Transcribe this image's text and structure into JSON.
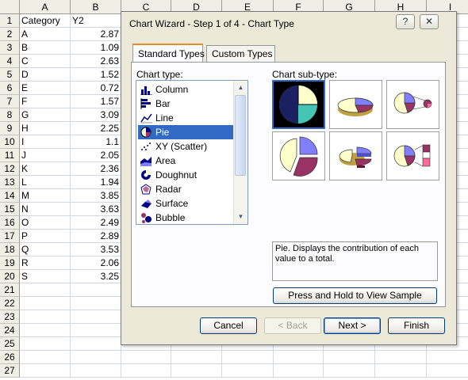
{
  "spreadsheet": {
    "columns": [
      "A",
      "B",
      "C",
      "D",
      "E",
      "F",
      "G",
      "H",
      "I"
    ],
    "rows": [
      {
        "n": "1",
        "a": "Category",
        "b": "Y2"
      },
      {
        "n": "2",
        "a": "A",
        "b": "2.87"
      },
      {
        "n": "3",
        "a": "B",
        "b": "1.09"
      },
      {
        "n": "4",
        "a": "C",
        "b": "2.63"
      },
      {
        "n": "5",
        "a": "D",
        "b": "1.52"
      },
      {
        "n": "6",
        "a": "E",
        "b": "0.72"
      },
      {
        "n": "7",
        "a": "F",
        "b": "1.57"
      },
      {
        "n": "8",
        "a": "G",
        "b": "3.09"
      },
      {
        "n": "9",
        "a": "H",
        "b": "2.25"
      },
      {
        "n": "10",
        "a": "I",
        "b": "1.1"
      },
      {
        "n": "11",
        "a": "J",
        "b": "2.05"
      },
      {
        "n": "12",
        "a": "K",
        "b": "2.36"
      },
      {
        "n": "13",
        "a": "L",
        "b": "1.94"
      },
      {
        "n": "14",
        "a": "M",
        "b": "3.85"
      },
      {
        "n": "15",
        "a": "N",
        "b": "3.63"
      },
      {
        "n": "16",
        "a": "O",
        "b": "2.49"
      },
      {
        "n": "17",
        "a": "P",
        "b": "2.89"
      },
      {
        "n": "18",
        "a": "Q",
        "b": "3.53"
      },
      {
        "n": "19",
        "a": "R",
        "b": "2.06"
      },
      {
        "n": "20",
        "a": "S",
        "b": "3.25"
      },
      {
        "n": "21",
        "a": "",
        "b": ""
      },
      {
        "n": "22",
        "a": "",
        "b": ""
      },
      {
        "n": "23",
        "a": "",
        "b": ""
      },
      {
        "n": "24",
        "a": "",
        "b": ""
      },
      {
        "n": "25",
        "a": "",
        "b": ""
      },
      {
        "n": "26",
        "a": "",
        "b": ""
      },
      {
        "n": "27",
        "a": "",
        "b": ""
      }
    ]
  },
  "dialog": {
    "title": "Chart Wizard - Step 1 of 4 - Chart Type",
    "help_label": "?",
    "close_label": "✕",
    "tabs": [
      {
        "label": "Standard Types",
        "active": true
      },
      {
        "label": "Custom Types",
        "active": false
      }
    ],
    "chart_type_label": "Chart type:",
    "chart_subtype_label": "Chart sub-type:",
    "chart_types": [
      {
        "label": "Column",
        "icon": "column-icon"
      },
      {
        "label": "Bar",
        "icon": "bar-icon"
      },
      {
        "label": "Line",
        "icon": "line-icon"
      },
      {
        "label": "Pie",
        "icon": "pie-icon",
        "selected": true
      },
      {
        "label": "XY (Scatter)",
        "icon": "scatter-icon"
      },
      {
        "label": "Area",
        "icon": "area-icon"
      },
      {
        "label": "Doughnut",
        "icon": "doughnut-icon"
      },
      {
        "label": "Radar",
        "icon": "radar-icon"
      },
      {
        "label": "Surface",
        "icon": "surface-icon"
      },
      {
        "label": "Bubble",
        "icon": "bubble-icon"
      }
    ],
    "description": "Pie. Displays the contribution of each value to a total.",
    "sample_button": "Press and Hold to View Sample",
    "buttons": {
      "cancel": "Cancel",
      "back": "< Back",
      "next": "Next >",
      "finish": "Finish"
    },
    "colors": {
      "selection": "#316ac5",
      "dialog_bg": "#ece9d8",
      "pie_purple": "#8080ff",
      "pie_maroon": "#993366",
      "pie_cream": "#ffffcc",
      "pie_teal": "#44c4b4",
      "pie_navy": "#1c2060"
    }
  }
}
